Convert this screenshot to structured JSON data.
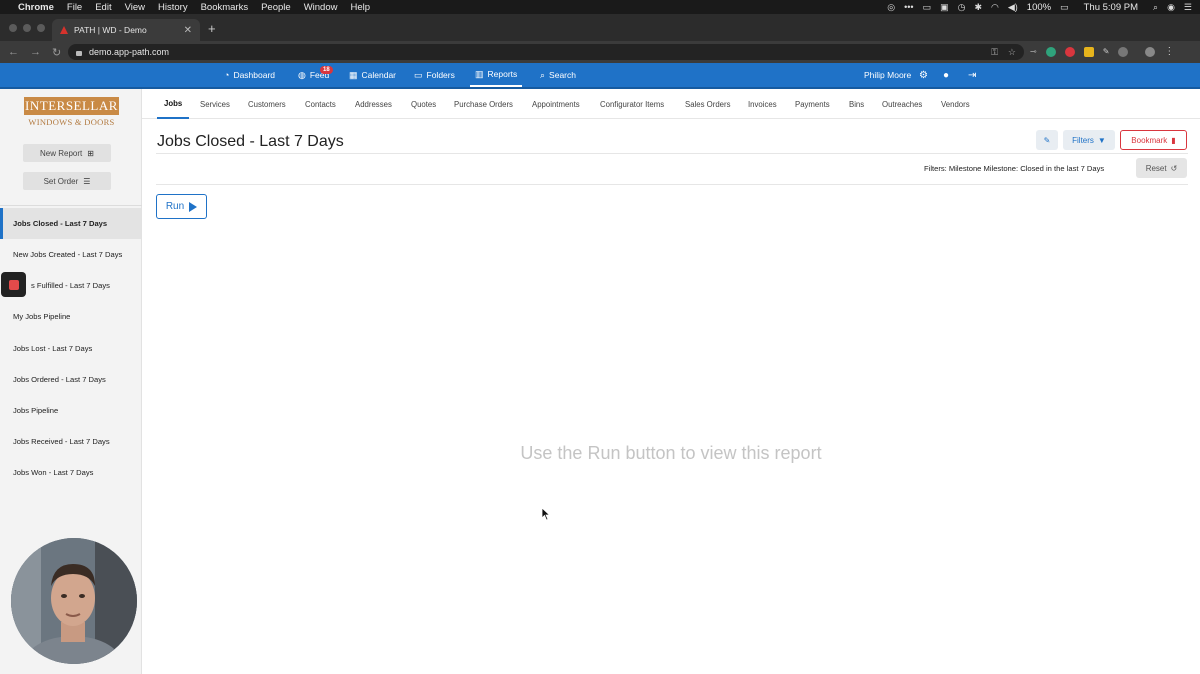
{
  "menubar": {
    "app": "Chrome",
    "items": [
      "File",
      "Edit",
      "View",
      "History",
      "Bookmarks",
      "People",
      "Window",
      "Help"
    ],
    "battery": "100%",
    "clock": "Thu 5:09 PM"
  },
  "browser": {
    "tab_title": "PATH | WD - Demo",
    "url": "demo.app-path.com"
  },
  "appnav": {
    "items": [
      {
        "label": "Dashboard",
        "icon": "dashboard-icon"
      },
      {
        "label": "Feed",
        "icon": "globe-icon",
        "badge": "18"
      },
      {
        "label": "Calendar",
        "icon": "calendar-icon"
      },
      {
        "label": "Folders",
        "icon": "folder-icon"
      },
      {
        "label": "Reports",
        "icon": "bar-chart-icon"
      },
      {
        "label": "Search",
        "icon": "search-icon"
      }
    ],
    "user_name": "Philip Moore",
    "accent_color": "#1f72c7"
  },
  "sidebar": {
    "logo_top": "INTERSELLAR",
    "logo_bottom": "WINDOWS & DOORS",
    "new_report_label": "New Report",
    "set_order_label": "Set Order",
    "reports": [
      "Jobs Closed - Last 7 Days",
      "New Jobs Created - Last 7 Days",
      "s Fulfilled - Last 7 Days",
      "My Jobs Pipeline",
      "Jobs Lost - Last 7 Days",
      "Jobs Ordered - Last 7 Days",
      "Jobs Pipeline",
      "Jobs Received - Last 7 Days",
      "Jobs Won - Last 7 Days"
    ]
  },
  "subtabs": [
    "Jobs",
    "Services",
    "Customers",
    "Contacts",
    "Addresses",
    "Quotes",
    "Purchase Orders",
    "Appointments",
    "Configurator Items",
    "Sales Orders",
    "Invoices",
    "Payments",
    "Bins",
    "Outreaches",
    "Vendors"
  ],
  "main": {
    "title": "Jobs Closed - Last 7 Days",
    "filters_label": "Filters",
    "bookmark_label": "Bookmark",
    "filters_text": "Filters: Milestone Milestone: Closed in the last 7 Days",
    "reset_label": "Reset",
    "run_label": "Run",
    "empty_message": "Use the Run button to view this report"
  }
}
